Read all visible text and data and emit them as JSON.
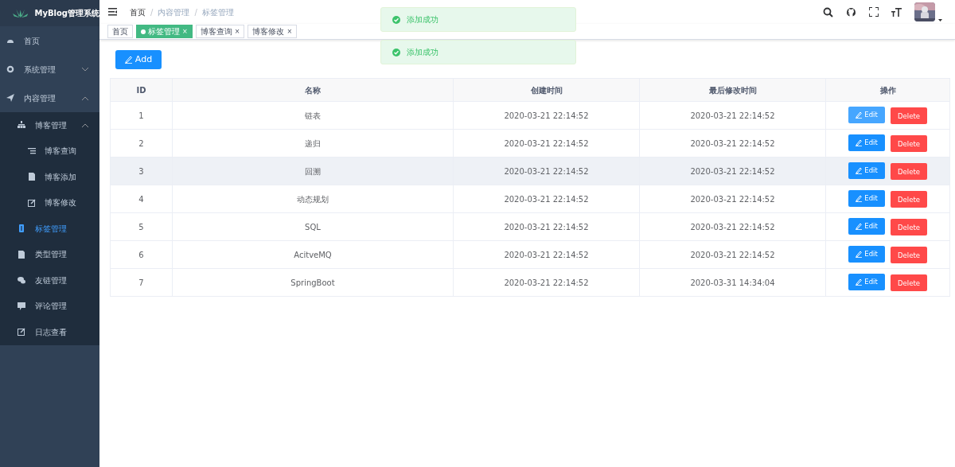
{
  "app": {
    "title": "MyBlog管理系统"
  },
  "sidebar": {
    "items": [
      {
        "label": "首页",
        "selected": false
      },
      {
        "label": "系统管理",
        "expanded": false,
        "selected": false
      },
      {
        "label": "内容管理",
        "expanded": true,
        "selected": false,
        "children": [
          {
            "label": "博客管理",
            "expanded": true,
            "selected": false,
            "children": [
              {
                "label": "博客查询",
                "selected": false
              },
              {
                "label": "博客添加",
                "selected": false
              },
              {
                "label": "博客修改",
                "selected": false
              }
            ]
          },
          {
            "label": "标签管理",
            "selected": true
          },
          {
            "label": "类型管理",
            "selected": false
          },
          {
            "label": "友链管理",
            "selected": false
          },
          {
            "label": "评论管理",
            "selected": false
          },
          {
            "label": "日志查看",
            "selected": false
          }
        ]
      }
    ]
  },
  "breadcrumb": {
    "separator": "/",
    "items": [
      "首页",
      "内容管理",
      "标签管理"
    ]
  },
  "tabs": [
    {
      "label": "首页",
      "selected": false
    },
    {
      "label": "标签管理",
      "selected": true,
      "close": "×"
    },
    {
      "label": "博客查询",
      "selected": false,
      "close": "×"
    },
    {
      "label": "博客修改",
      "selected": false,
      "close": "×"
    }
  ],
  "toasts": [
    {
      "message": "添加成功"
    },
    {
      "message": "添加成功"
    }
  ],
  "add_button": {
    "label": "Add"
  },
  "table": {
    "columns": [
      "ID",
      "名称",
      "创建时间",
      "最后修改时间",
      "操作"
    ],
    "rows": [
      {
        "id": "1",
        "name": "链表",
        "created": "2020-03-21 22:14:52",
        "modified": "2020-03-21 22:14:52",
        "highlighted": false,
        "edit_label": "Edit",
        "edit_focused": true,
        "delete_label": "Delete"
      },
      {
        "id": "2",
        "name": "递归",
        "created": "2020-03-21 22:14:52",
        "modified": "2020-03-21 22:14:52",
        "highlighted": false,
        "edit_label": "Edit",
        "edit_focused": false,
        "delete_label": "Delete"
      },
      {
        "id": "3",
        "name": "回溯",
        "created": "2020-03-21 22:14:52",
        "modified": "2020-03-21 22:14:52",
        "highlighted": true,
        "edit_label": "Edit",
        "edit_focused": false,
        "delete_label": "Delete"
      },
      {
        "id": "4",
        "name": "动态规划",
        "created": "2020-03-21 22:14:52",
        "modified": "2020-03-21 22:14:52",
        "highlighted": false,
        "edit_label": "Edit",
        "edit_focused": false,
        "delete_label": "Delete"
      },
      {
        "id": "5",
        "name": "SQL",
        "created": "2020-03-21 22:14:52",
        "modified": "2020-03-21 22:14:52",
        "highlighted": false,
        "edit_label": "Edit",
        "edit_focused": false,
        "delete_label": "Delete"
      },
      {
        "id": "6",
        "name": "AcitveMQ",
        "created": "2020-03-21 22:14:52",
        "modified": "2020-03-21 22:14:52",
        "highlighted": false,
        "edit_label": "Edit",
        "edit_focused": false,
        "delete_label": "Delete"
      },
      {
        "id": "7",
        "name": "SpringBoot",
        "created": "2020-03-21 22:14:52",
        "modified": "2020-03-31 14:34:04",
        "highlighted": false,
        "edit_label": "Edit",
        "edit_focused": false,
        "delete_label": "Delete"
      }
    ]
  }
}
